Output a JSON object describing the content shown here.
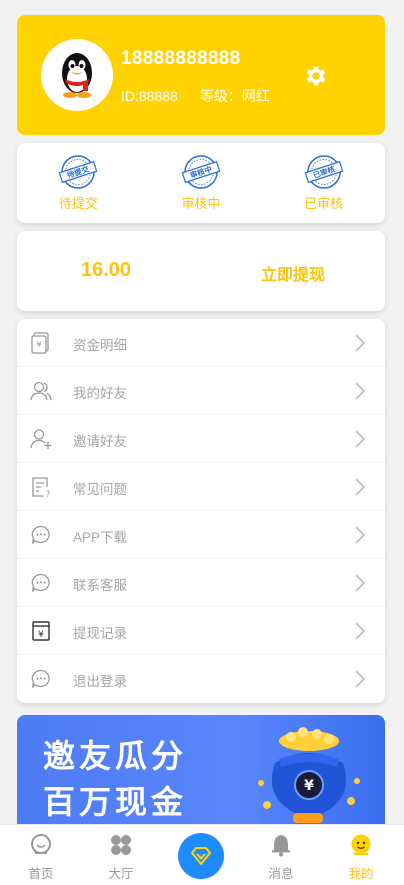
{
  "profile": {
    "phone": "18888888888",
    "id_text": "ID:88888",
    "level_text": "等级：网红"
  },
  "status": [
    {
      "stamp": "待提交",
      "label": "待提交"
    },
    {
      "stamp": "审核中",
      "label": "审核中"
    },
    {
      "stamp": "已审核",
      "label": "已审核"
    }
  ],
  "wallet": {
    "balance": "16.00",
    "withdraw_label": "立即提现"
  },
  "menu": [
    {
      "label": "资金明细",
      "icon": "wallet-icon"
    },
    {
      "label": "我的好友",
      "icon": "friends-icon"
    },
    {
      "label": "邀请好友",
      "icon": "invite-user-icon"
    },
    {
      "label": "常见问题",
      "icon": "faq-icon"
    },
    {
      "label": "APP下载",
      "icon": "chat-bubble-icon"
    },
    {
      "label": "联系客服",
      "icon": "chat-bubble-icon"
    },
    {
      "label": "提现记录",
      "icon": "yuan-record-icon"
    },
    {
      "label": "退出登录",
      "icon": "chat-bubble-icon"
    }
  ],
  "banner": {
    "line1": "邀友瓜分",
    "line2": "百万现金",
    "bag_symbol": "¥"
  },
  "tabbar": {
    "home": "首页",
    "hall": "大厅",
    "messages": "消息",
    "mine": "我的",
    "active": "mine"
  },
  "colors": {
    "brand_yellow": "#ffd200",
    "accent_text": "#ffc20e",
    "stamp_blue": "#2a6fd6",
    "center_blue": "#1e8cff"
  }
}
